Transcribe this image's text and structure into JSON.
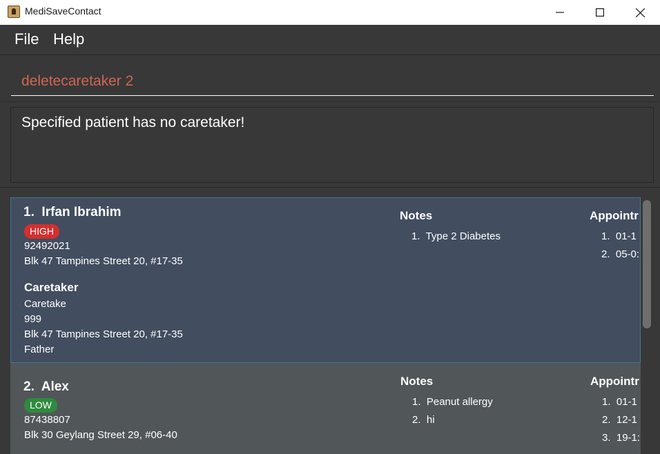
{
  "window": {
    "title": "MediSaveContact",
    "controls": {
      "minimize_icon": "minimize-icon",
      "maximize_icon": "maximize-icon",
      "close_icon": "close-icon"
    }
  },
  "menu": {
    "items": [
      {
        "label": "File"
      },
      {
        "label": "Help"
      }
    ]
  },
  "command": {
    "value": "deletecaretaker 2",
    "text_color": "#d06651"
  },
  "result": {
    "text": "Specified patient has no caretaker!"
  },
  "persons": [
    {
      "index": "1.",
      "name": "Irfan Ibrahim",
      "priority": "HIGH",
      "priority_color": "#d32f2f",
      "phone": "92492021",
      "address": "Blk 47 Tampines Street 20, #17-35",
      "caretaker_heading": "Caretaker",
      "caretaker": {
        "name": "Caretake",
        "phone": "999",
        "address": "Blk 47 Tampines Street 20, #17-35",
        "relationship": "Father"
      },
      "notes_heading": "Notes",
      "notes": [
        {
          "num": "1.",
          "text": "Type 2 Diabetes"
        }
      ],
      "appointments_heading": "Appointr",
      "appointments": [
        {
          "num": "1.",
          "text": "01-1"
        },
        {
          "num": "2.",
          "text": "05-0:"
        }
      ]
    },
    {
      "index": "2.",
      "name": "Alex",
      "priority": "LOW",
      "priority_color": "#2e8b3e",
      "phone": "87438807",
      "address": "Blk 30 Geylang Street 29, #06-40",
      "notes_heading": "Notes",
      "notes": [
        {
          "num": "1.",
          "text": "Peanut allergy"
        },
        {
          "num": "2.",
          "text": "hi"
        }
      ],
      "appointments_heading": "Appointr",
      "appointments": [
        {
          "num": "1.",
          "text": "01-1"
        },
        {
          "num": "2.",
          "text": "12-1"
        },
        {
          "num": "3.",
          "text": "19-1:"
        }
      ]
    }
  ],
  "colors": {
    "selected_card": "#424d5f",
    "selected_border": "#3e7b91",
    "card": "#515658",
    "background": "#383838"
  }
}
